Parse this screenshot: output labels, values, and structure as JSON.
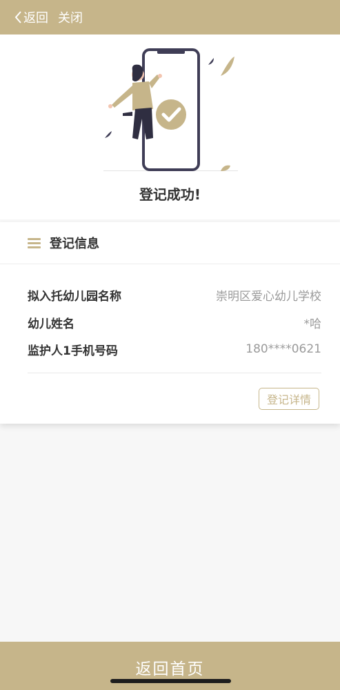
{
  "nav": {
    "back_label": "返回",
    "close_label": "关闭"
  },
  "hero": {
    "title": "登记成功!",
    "illustration": "success-phone-illustration"
  },
  "card": {
    "title": "登记信息",
    "rows": [
      {
        "label": "拟入托幼儿园名称",
        "value": "崇明区爱心幼儿学校"
      },
      {
        "label": "幼儿姓名",
        "value": "*哈"
      },
      {
        "label": "监护人1手机号码",
        "value": "180****0621"
      }
    ],
    "detail_button": "登记详情"
  },
  "bottom": {
    "home_label": "返回首页"
  },
  "colors": {
    "accent": "#c6b58a",
    "background": "#f7f7f7",
    "card": "#ffffff"
  }
}
